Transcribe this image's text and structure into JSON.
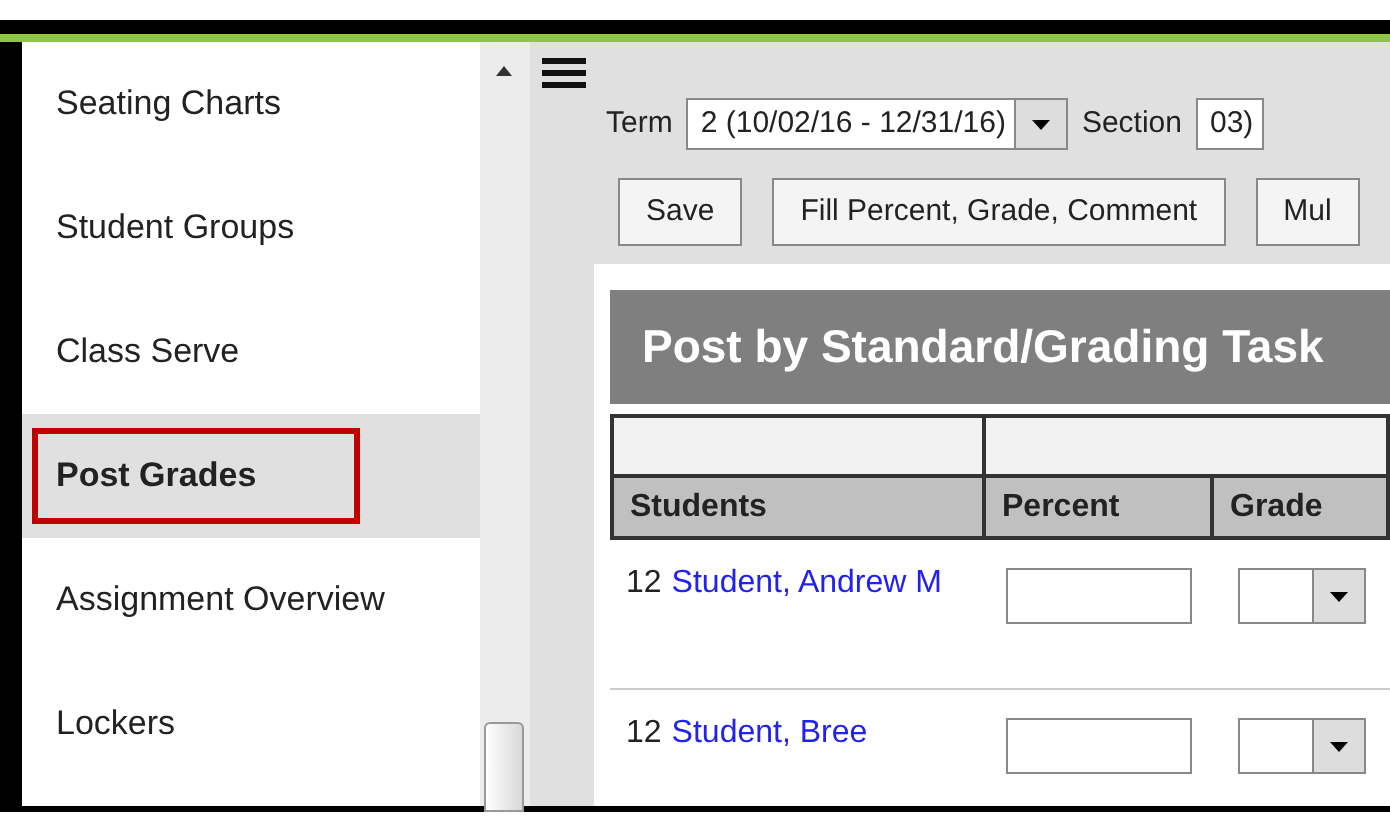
{
  "sidebar": {
    "items": [
      {
        "label": "Seating Charts",
        "selected": false
      },
      {
        "label": "Student Groups",
        "selected": false
      },
      {
        "label": "Class Serve",
        "selected": false
      },
      {
        "label": "Post Grades",
        "selected": true
      },
      {
        "label": "Assignment Overview",
        "selected": false
      },
      {
        "label": "Lockers",
        "selected": false
      }
    ]
  },
  "filters": [
    {
      "label": "Term",
      "value": "2 (10/02/16 - 12/31/16)"
    },
    {
      "label": "Section",
      "value": "03)"
    }
  ],
  "buttons": [
    "Save",
    "Fill Percent, Grade, Comment",
    "Mul"
  ],
  "panel": {
    "title": "Post by Standard/Grading Task",
    "columns": [
      "Students",
      "Percent",
      "Grade"
    ],
    "rows": [
      {
        "grade": "12",
        "name": "Student, Andrew M"
      },
      {
        "grade": "12",
        "name": "Student, Bree"
      }
    ]
  }
}
